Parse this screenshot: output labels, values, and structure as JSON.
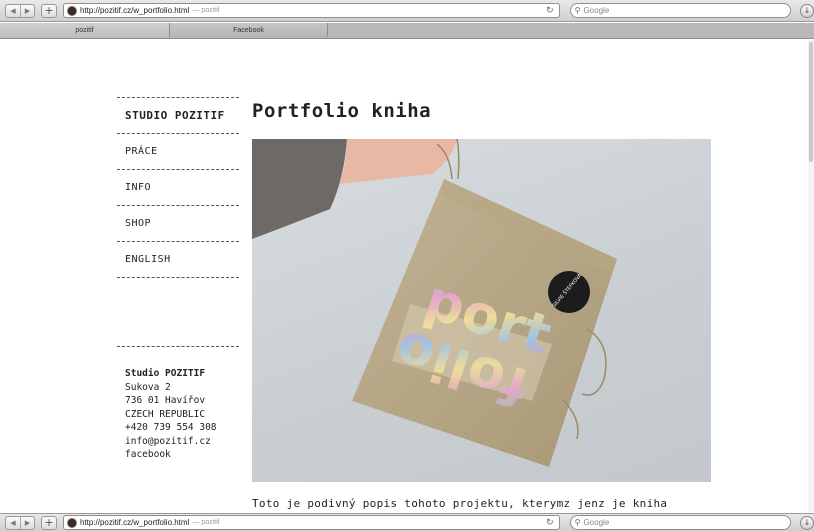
{
  "browser": {
    "url": "http://pozitif.cz/w_portfolio.html",
    "page_title": "— pozitif",
    "search_placeholder": "Google",
    "tabs": [
      "pozitif",
      "Facebook"
    ]
  },
  "sidebar": {
    "items": [
      {
        "label": "STUDIO POZITIF",
        "active": true
      },
      {
        "label": "PRÁCE"
      },
      {
        "label": "INFO"
      },
      {
        "label": "SHOP"
      },
      {
        "label": "ENGLISH"
      }
    ]
  },
  "contact": {
    "name": "Studio POZITIF",
    "street": "Sukova 2",
    "city": "736 01 Havířov",
    "country": "CZECH REPUBLIC",
    "phone": "+420 739 554 308",
    "email": "info@pozitif.cz",
    "facebook": "facebook"
  },
  "main": {
    "title": "Portfolio kniha",
    "photo_text": {
      "hologram": "port folio",
      "sticker": "SILVIE ŠTEFKOVÁ"
    },
    "description": "Toto je podivný popis tohoto projektu, kterymz jenz je kniha"
  },
  "colors": {
    "text": "#222222",
    "background": "#ffffff",
    "sticker": "#1c1c1c"
  }
}
